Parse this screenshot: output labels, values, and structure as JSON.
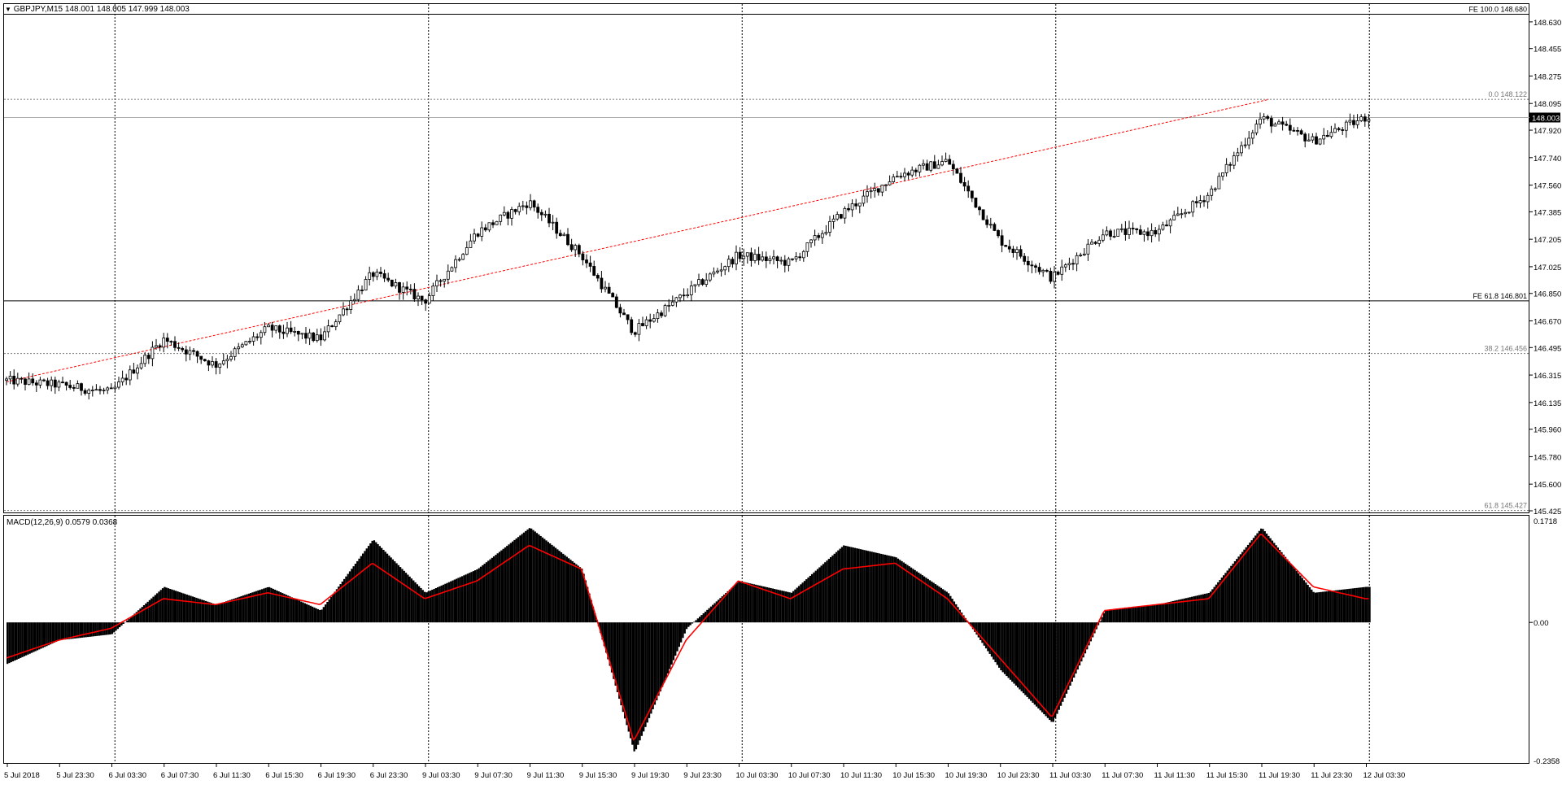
{
  "main_panel": {
    "symbol": "GBPJPY,M15",
    "ohlc": "148.001 148.005 147.999 148.003",
    "dropdown_icon": "triangle-down-icon",
    "price_axis": [
      "148.630",
      "148.455",
      "148.275",
      "148.095",
      "147.920",
      "147.740",
      "147.560",
      "147.385",
      "147.205",
      "147.025",
      "146.850",
      "146.670",
      "146.495",
      "146.315",
      "146.135",
      "145.960",
      "145.780",
      "145.600",
      "145.425"
    ],
    "current_price": "148.003",
    "levels": [
      {
        "label": "FE 100.0 148.680",
        "price": 148.68,
        "style": "solid"
      },
      {
        "label": "0.0 148.122",
        "price": 148.122,
        "style": "dotted"
      },
      {
        "label": "FE 61.8 146.801",
        "price": 146.801,
        "style": "solid"
      },
      {
        "label": "38.2 146.456",
        "price": 146.456,
        "style": "dotted"
      },
      {
        "label": "61.8 145.427",
        "price": 145.427,
        "style": "dotted"
      }
    ],
    "trendline_color": "#ff0000"
  },
  "macd_panel": {
    "title": "MACD(12,26,9)",
    "values": "0.0579 0.0368",
    "axis": [
      "0.1718",
      "0.00",
      "-0.2358"
    ],
    "histogram_color": "#000000",
    "signal_color": "#ff0000"
  },
  "time_axis": [
    "5 Jul 2018",
    "5 Jul 23:30",
    "6 Jul 03:30",
    "6 Jul 07:30",
    "6 Jul 11:30",
    "6 Jul 15:30",
    "6 Jul 19:30",
    "6 Jul 23:30",
    "9 Jul 03:30",
    "9 Jul 07:30",
    "9 Jul 11:30",
    "9 Jul 15:30",
    "9 Jul 19:30",
    "9 Jul 23:30",
    "10 Jul 03:30",
    "10 Jul 07:30",
    "10 Jul 11:30",
    "10 Jul 15:30",
    "10 Jul 19:30",
    "10 Jul 23:30",
    "11 Jul 03:30",
    "11 Jul 07:30",
    "11 Jul 11:30",
    "11 Jul 15:30",
    "11 Jul 19:30",
    "11 Jul 23:30",
    "12 Jul 03:30"
  ],
  "chart_data": [
    {
      "type": "candlestick",
      "title": "GBPJPY,M15",
      "timeframe": "M15",
      "ylim": [
        145.425,
        148.72
      ],
      "grid": true,
      "price_path": [
        {
          "t": "5 Jul 2018",
          "price": 146.28
        },
        {
          "t": "5 Jul 23:30",
          "price": 146.25
        },
        {
          "t": "6 Jul 03:30",
          "price": 146.2
        },
        {
          "t": "6 Jul 07:30",
          "price": 146.55
        },
        {
          "t": "6 Jul 11:30",
          "price": 146.38
        },
        {
          "t": "6 Jul 15:30",
          "price": 146.62
        },
        {
          "t": "6 Jul 19:30",
          "price": 146.55
        },
        {
          "t": "6 Jul 23:30",
          "price": 146.98
        },
        {
          "t": "9 Jul 03:30",
          "price": 146.8
        },
        {
          "t": "9 Jul 07:30",
          "price": 147.25
        },
        {
          "t": "9 Jul 11:30",
          "price": 147.45
        },
        {
          "t": "9 Jul 15:30",
          "price": 147.1
        },
        {
          "t": "9 Jul 19:30",
          "price": 146.6
        },
        {
          "t": "9 Jul 23:30",
          "price": 146.85
        },
        {
          "t": "10 Jul 03:30",
          "price": 147.1
        },
        {
          "t": "10 Jul 07:30",
          "price": 147.05
        },
        {
          "t": "10 Jul 11:30",
          "price": 147.38
        },
        {
          "t": "10 Jul 15:30",
          "price": 147.62
        },
        {
          "t": "10 Jul 19:30",
          "price": 147.72
        },
        {
          "t": "10 Jul 23:30",
          "price": 147.2
        },
        {
          "t": "11 Jul 03:30",
          "price": 146.95
        },
        {
          "t": "11 Jul 07:30",
          "price": 147.25
        },
        {
          "t": "11 Jul 11:30",
          "price": 147.25
        },
        {
          "t": "11 Jul 15:30",
          "price": 147.5
        },
        {
          "t": "11 Jul 19:30",
          "price": 148.0
        },
        {
          "t": "11 Jul 23:30",
          "price": 147.85
        },
        {
          "t": "12 Jul 03:30",
          "price": 148.003
        }
      ]
    },
    {
      "type": "bar",
      "title": "MACD(12,26,9)",
      "ylim": [
        -0.2358,
        0.1718
      ],
      "macd": 0.0579,
      "signal": 0.0368,
      "histogram_path": [
        {
          "t": "5 Jul 2018",
          "value": -0.07
        },
        {
          "t": "5 Jul 23:30",
          "value": -0.03
        },
        {
          "t": "6 Jul 03:30",
          "value": -0.02
        },
        {
          "t": "6 Jul 07:30",
          "value": 0.06
        },
        {
          "t": "6 Jul 11:30",
          "value": 0.03
        },
        {
          "t": "6 Jul 15:30",
          "value": 0.06
        },
        {
          "t": "6 Jul 19:30",
          "value": 0.02
        },
        {
          "t": "6 Jul 23:30",
          "value": 0.14
        },
        {
          "t": "9 Jul 03:30",
          "value": 0.05
        },
        {
          "t": "9 Jul 07:30",
          "value": 0.09
        },
        {
          "t": "9 Jul 11:30",
          "value": 0.16
        },
        {
          "t": "9 Jul 15:30",
          "value": 0.09
        },
        {
          "t": "9 Jul 19:30",
          "value": -0.22
        },
        {
          "t": "9 Jul 23:30",
          "value": -0.01
        },
        {
          "t": "10 Jul 03:30",
          "value": 0.07
        },
        {
          "t": "10 Jul 07:30",
          "value": 0.05
        },
        {
          "t": "10 Jul 11:30",
          "value": 0.13
        },
        {
          "t": "10 Jul 15:30",
          "value": 0.11
        },
        {
          "t": "10 Jul 19:30",
          "value": 0.05
        },
        {
          "t": "10 Jul 23:30",
          "value": -0.08
        },
        {
          "t": "11 Jul 03:30",
          "value": -0.17
        },
        {
          "t": "11 Jul 07:30",
          "value": 0.02
        },
        {
          "t": "11 Jul 11:30",
          "value": 0.03
        },
        {
          "t": "11 Jul 15:30",
          "value": 0.05
        },
        {
          "t": "11 Jul 19:30",
          "value": 0.16
        },
        {
          "t": "11 Jul 23:30",
          "value": 0.05
        },
        {
          "t": "12 Jul 03:30",
          "value": 0.06
        }
      ],
      "signal_path": [
        {
          "t": "5 Jul 2018",
          "value": -0.06
        },
        {
          "t": "5 Jul 23:30",
          "value": -0.03
        },
        {
          "t": "6 Jul 03:30",
          "value": -0.01
        },
        {
          "t": "6 Jul 07:30",
          "value": 0.04
        },
        {
          "t": "6 Jul 11:30",
          "value": 0.03
        },
        {
          "t": "6 Jul 15:30",
          "value": 0.05
        },
        {
          "t": "6 Jul 19:30",
          "value": 0.03
        },
        {
          "t": "6 Jul 23:30",
          "value": 0.1
        },
        {
          "t": "9 Jul 03:30",
          "value": 0.04
        },
        {
          "t": "9 Jul 07:30",
          "value": 0.07
        },
        {
          "t": "9 Jul 11:30",
          "value": 0.13
        },
        {
          "t": "9 Jul 15:30",
          "value": 0.09
        },
        {
          "t": "9 Jul 19:30",
          "value": -0.2
        },
        {
          "t": "9 Jul 23:30",
          "value": -0.03
        },
        {
          "t": "10 Jul 03:30",
          "value": 0.07
        },
        {
          "t": "10 Jul 07:30",
          "value": 0.04
        },
        {
          "t": "10 Jul 11:30",
          "value": 0.09
        },
        {
          "t": "10 Jul 15:30",
          "value": 0.1
        },
        {
          "t": "10 Jul 19:30",
          "value": 0.04
        },
        {
          "t": "10 Jul 23:30",
          "value": -0.06
        },
        {
          "t": "11 Jul 03:30",
          "value": -0.16
        },
        {
          "t": "11 Jul 07:30",
          "value": 0.02
        },
        {
          "t": "11 Jul 11:30",
          "value": 0.03
        },
        {
          "t": "11 Jul 15:30",
          "value": 0.04
        },
        {
          "t": "11 Jul 19:30",
          "value": 0.15
        },
        {
          "t": "11 Jul 23:30",
          "value": 0.06
        },
        {
          "t": "12 Jul 03:30",
          "value": 0.04
        }
      ]
    }
  ]
}
